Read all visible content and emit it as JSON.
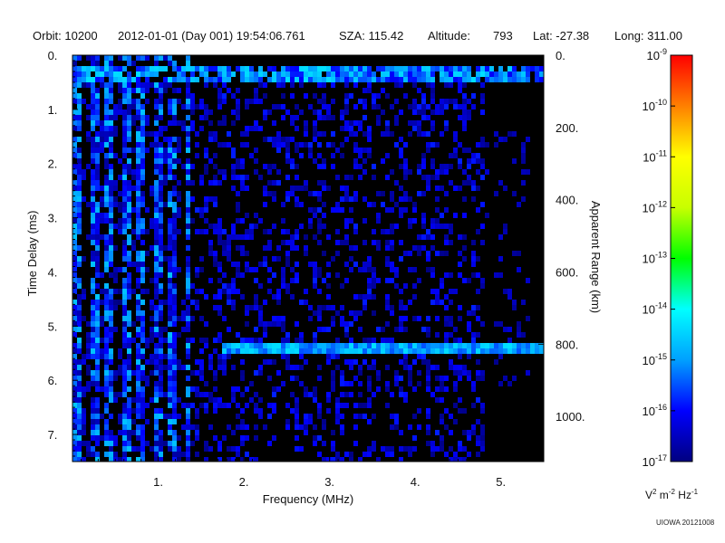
{
  "header": {
    "orbit": "Orbit: 10200",
    "datetime": "2012-01-01 (Day 001) 19:54:06.761",
    "sza": "SZA: 115.42",
    "altitude_label": "Altitude:",
    "altitude_value": "793",
    "lat": "Lat: -27.38",
    "long": "Long: 311.00"
  },
  "colorbar": {
    "unit_parts": [
      "V",
      "2",
      " m",
      "-2",
      " Hz",
      "-1"
    ],
    "tick_labels": [
      {
        "base": "10",
        "exp": "-9",
        "value": -9
      },
      {
        "base": "10",
        "exp": "-10",
        "value": -10
      },
      {
        "base": "10",
        "exp": "-11",
        "value": -11
      },
      {
        "base": "10",
        "exp": "-12",
        "value": -12
      },
      {
        "base": "10",
        "exp": "-13",
        "value": -13
      },
      {
        "base": "10",
        "exp": "-14",
        "value": -14
      },
      {
        "base": "10",
        "exp": "-15",
        "value": -15
      },
      {
        "base": "10",
        "exp": "-16",
        "value": -16
      },
      {
        "base": "10",
        "exp": "-17",
        "value": -17
      }
    ],
    "scale": "log",
    "range": [
      -17,
      -9
    ],
    "colors": [
      "#000080",
      "#0000ff",
      "#00a0ff",
      "#00ffff",
      "#00ff00",
      "#c8ff00",
      "#ffff00",
      "#ff8000",
      "#ff0000"
    ]
  },
  "credit": "UIOWA 20121008",
  "chart_data": {
    "type": "heatmap",
    "xlabel": "Frequency (MHz)",
    "ylabel_left": "Time Delay (ms)",
    "ylabel_right": "Apparent Range (km)",
    "xlim": [
      0.0,
      5.5
    ],
    "ylim_left": [
      0.0,
      7.5
    ],
    "ylim_right": [
      0,
      1125
    ],
    "x_ticks": [
      1,
      2,
      3,
      4,
      5
    ],
    "x_tick_labels": [
      "1.",
      "2.",
      "3.",
      "4.",
      "5."
    ],
    "y_ticks": [
      0,
      1,
      2,
      3,
      4,
      5,
      6,
      7
    ],
    "y_tick_labels": [
      "0.",
      "1.",
      "2.",
      "3.",
      "4.",
      "5.",
      "6.",
      "7."
    ],
    "right_ticks": [
      0,
      200,
      400,
      600,
      800,
      1000
    ],
    "right_tick_labels": [
      "0.",
      "200.",
      "400.",
      "600.",
      "800.",
      "1000."
    ],
    "background": "#000000",
    "features": [
      {
        "name": "surface-echo-band",
        "delay_ms": [
          0.25,
          0.5
        ],
        "freq_mhz": [
          0.0,
          5.5
        ],
        "level_log10": -14.5
      },
      {
        "name": "low-frequency-vertical-streaks",
        "delay_ms": [
          0.3,
          7.5
        ],
        "freq_mhz": [
          0.0,
          1.35
        ],
        "level_log10": -15.5
      },
      {
        "name": "ground-echo-trace",
        "delay_ms": 5.35,
        "freq_mhz": [
          1.7,
          5.5
        ],
        "level_log10": -14.8
      },
      {
        "name": "diffuse-noise",
        "delay_ms": [
          0.5,
          7.5
        ],
        "freq_mhz": [
          1.35,
          4.8
        ],
        "level_log10": -16.3
      }
    ]
  }
}
